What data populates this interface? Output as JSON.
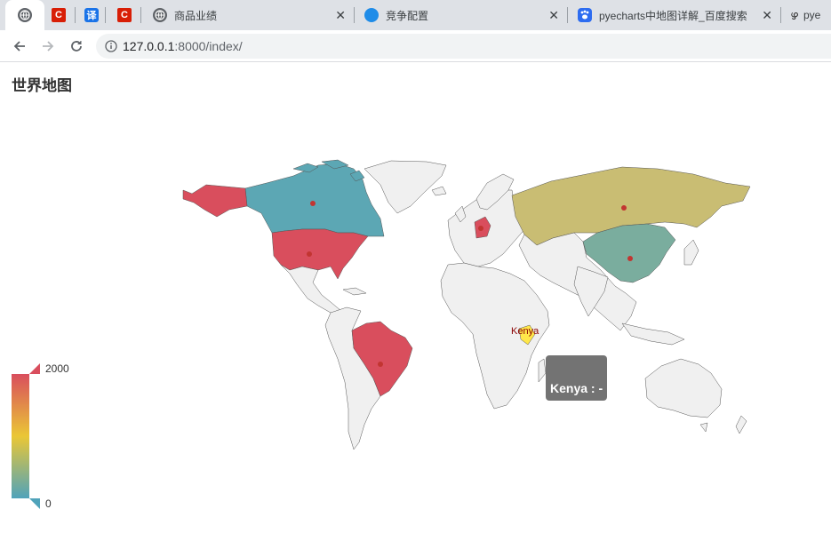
{
  "browser": {
    "tabs": [
      {
        "title": "",
        "icon": "globe-icon",
        "active": true
      },
      {
        "title": "",
        "icon": "c-app-icon"
      },
      {
        "title": "",
        "icon": "translate-icon",
        "glyph": "译"
      },
      {
        "title": "",
        "icon": "c-app-icon"
      },
      {
        "title": "商品业绩",
        "icon": "globe-icon"
      },
      {
        "title": "竞争配置",
        "icon": "edge-icon"
      },
      {
        "title": "pyecharts中地图详解_百度搜索",
        "icon": "baidu-paw-icon"
      },
      {
        "title": "pye",
        "icon": "python-icon"
      }
    ],
    "url_host": "127.0.0.1",
    "url_rest": ":8000/index/"
  },
  "page": {
    "title": "世界地图"
  },
  "map": {
    "highlight_label": "Kenya",
    "tooltip": "Kenya : -",
    "visual_map": {
      "max": "2000",
      "min": "0",
      "colors": [
        "#d94e5d",
        "#eac736",
        "#50a3ba"
      ]
    },
    "colors": {
      "high": "#d94e5d",
      "mid_teal": "#5ca7b4",
      "olive": "#c9bd73",
      "green": "#7aad9e",
      "none": "#f0f0f0",
      "hover": "#ffe74a",
      "dot": "#c23531"
    }
  }
}
